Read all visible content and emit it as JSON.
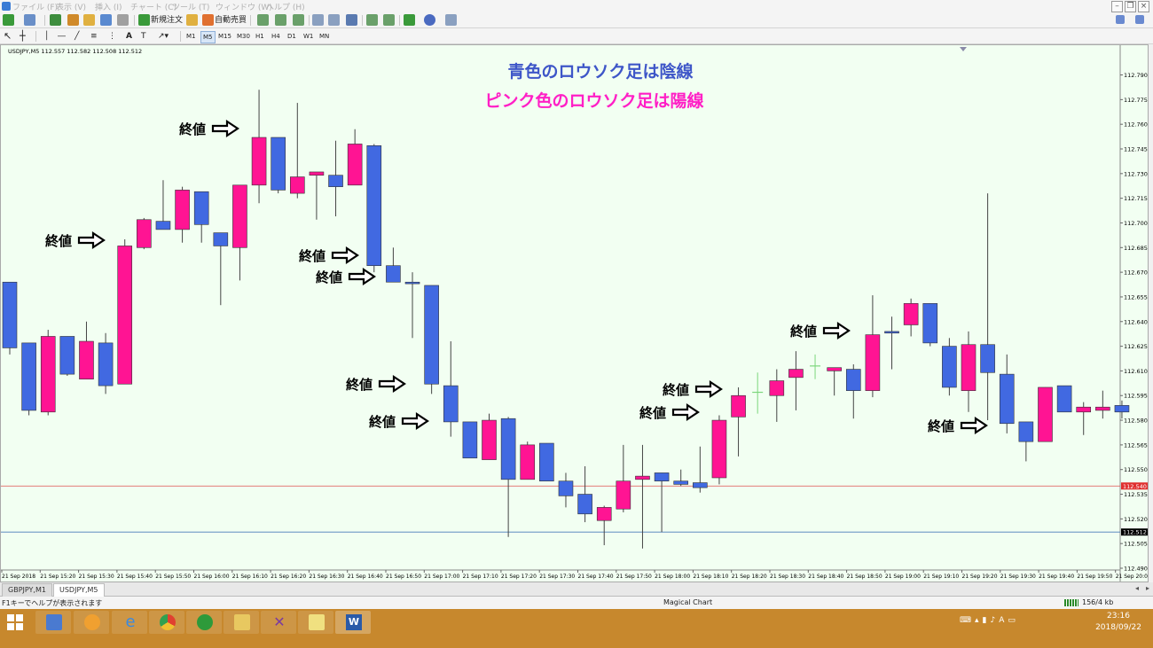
{
  "menubar": {
    "items": [
      "ファイル (F)",
      "表示 (V)",
      "挿入 (I)",
      "チャート (C)",
      "ツール (T)",
      "ウィンドウ (W)",
      "ヘルプ (H)"
    ]
  },
  "toolbar1": {
    "new_order_label": "新規注文",
    "auto_trade_label": "自動売買"
  },
  "toolbar2": {
    "timeframes": [
      "M1",
      "M5",
      "M15",
      "M30",
      "H1",
      "H4",
      "D1",
      "W1",
      "MN"
    ],
    "active_timeframe": "M5"
  },
  "chart_info": "USDJPY,M5  112.557 112.582 112.508 112.512",
  "annotations": {
    "line1": "青色のロウソク足は陰線",
    "line2": "ピンク色のロウソク足は陽線",
    "close_label": "終値"
  },
  "colors": {
    "bear_candle": "#4169e1",
    "bull_candle": "#ff1493",
    "annotation_blue": "#3e56c8",
    "annotation_pink": "#ff1fc6",
    "chart_bg": "#f2fff2",
    "red_line": "#e05050",
    "blue_line": "#4a7ab8",
    "doji_green": "#7cd67c",
    "taskbar": "#c7882d"
  },
  "chart_data": {
    "type": "candlestick",
    "ylim": [
      112.49,
      112.807
    ],
    "y_ticks": [
      "112.790",
      "112.775",
      "112.760",
      "112.745",
      "112.730",
      "112.715",
      "112.700",
      "112.685",
      "112.670",
      "112.655",
      "112.640",
      "112.625",
      "112.610",
      "112.595",
      "112.580",
      "112.565",
      "112.550",
      "112.535",
      "112.520",
      "112.505",
      "112.490"
    ],
    "x_ticks": [
      "21 Sep 2018",
      "21 Sep 15:20",
      "21 Sep 15:30",
      "21 Sep 15:40",
      "21 Sep 15:50",
      "21 Sep 16:00",
      "21 Sep 16:10",
      "21 Sep 16:20",
      "21 Sep 16:30",
      "21 Sep 16:40",
      "21 Sep 16:50",
      "21 Sep 17:00",
      "21 Sep 17:10",
      "21 Sep 17:20",
      "21 Sep 17:30",
      "21 Sep 17:40",
      "21 Sep 17:50",
      "21 Sep 18:00",
      "21 Sep 18:10",
      "21 Sep 18:20",
      "21 Sep 18:30",
      "21 Sep 18:40",
      "21 Sep 18:50",
      "21 Sep 19:00",
      "21 Sep 19:10",
      "21 Sep 19:20",
      "21 Sep 19:30",
      "21 Sep 19:40",
      "21 Sep 19:50",
      "21 Sep 20:00"
    ],
    "price_levels": [
      {
        "value": 112.54,
        "label": "112.540",
        "color": "#e05050"
      },
      {
        "value": 112.512,
        "label": "112.512",
        "color": "#4a7ab8"
      }
    ],
    "candles": [
      {
        "o": 112.664,
        "h": 112.664,
        "l": 112.62,
        "c": 112.624,
        "dir": "bear"
      },
      {
        "o": 112.627,
        "h": 112.627,
        "l": 112.583,
        "c": 112.586,
        "dir": "bear"
      },
      {
        "o": 112.585,
        "h": 112.635,
        "l": 112.583,
        "c": 112.631,
        "dir": "bull"
      },
      {
        "o": 112.631,
        "h": 112.631,
        "l": 112.607,
        "c": 112.608,
        "dir": "bear"
      },
      {
        "o": 112.605,
        "h": 112.64,
        "l": 112.605,
        "c": 112.628,
        "dir": "bull"
      },
      {
        "o": 112.627,
        "h": 112.633,
        "l": 112.596,
        "c": 112.601,
        "dir": "bear"
      },
      {
        "o": 112.602,
        "h": 112.69,
        "l": 112.602,
        "c": 112.686,
        "dir": "bull"
      },
      {
        "o": 112.685,
        "h": 112.703,
        "l": 112.684,
        "c": 112.702,
        "dir": "bull"
      },
      {
        "o": 112.701,
        "h": 112.726,
        "l": 112.7,
        "c": 112.696,
        "dir": "bear"
      },
      {
        "o": 112.696,
        "h": 112.722,
        "l": 112.688,
        "c": 112.72,
        "dir": "bull"
      },
      {
        "o": 112.719,
        "h": 112.719,
        "l": 112.688,
        "c": 112.699,
        "dir": "bear"
      },
      {
        "o": 112.694,
        "h": 112.694,
        "l": 112.65,
        "c": 112.686,
        "dir": "bear"
      },
      {
        "o": 112.685,
        "h": 112.723,
        "l": 112.665,
        "c": 112.723,
        "dir": "bull"
      },
      {
        "o": 112.723,
        "h": 112.781,
        "l": 112.712,
        "c": 112.752,
        "dir": "bull"
      },
      {
        "o": 112.752,
        "h": 112.752,
        "l": 112.718,
        "c": 112.72,
        "dir": "bear"
      },
      {
        "o": 112.718,
        "h": 112.773,
        "l": 112.715,
        "c": 112.728,
        "dir": "bull"
      },
      {
        "o": 112.729,
        "h": 112.729,
        "l": 112.702,
        "c": 112.731,
        "dir": "bull"
      },
      {
        "o": 112.729,
        "h": 112.75,
        "l": 112.704,
        "c": 112.722,
        "dir": "bear"
      },
      {
        "o": 112.723,
        "h": 112.757,
        "l": 112.723,
        "c": 112.748,
        "dir": "bull"
      },
      {
        "o": 112.747,
        "h": 112.748,
        "l": 112.67,
        "c": 112.674,
        "dir": "bear"
      },
      {
        "o": 112.674,
        "h": 112.685,
        "l": 112.665,
        "c": 112.664,
        "dir": "bear"
      },
      {
        "o": 112.664,
        "h": 112.67,
        "l": 112.63,
        "c": 112.663,
        "dir": "bear"
      },
      {
        "o": 112.662,
        "h": 112.662,
        "l": 112.596,
        "c": 112.602,
        "dir": "bear"
      },
      {
        "o": 112.601,
        "h": 112.628,
        "l": 112.57,
        "c": 112.579,
        "dir": "bear"
      },
      {
        "o": 112.579,
        "h": 112.579,
        "l": 112.557,
        "c": 112.557,
        "dir": "bear"
      },
      {
        "o": 112.556,
        "h": 112.584,
        "l": 112.556,
        "c": 112.58,
        "dir": "bull"
      },
      {
        "o": 112.581,
        "h": 112.582,
        "l": 112.509,
        "c": 112.544,
        "dir": "bear"
      },
      {
        "o": 112.544,
        "h": 112.567,
        "l": 112.544,
        "c": 112.565,
        "dir": "bull"
      },
      {
        "o": 112.566,
        "h": 112.566,
        "l": 112.543,
        "c": 112.543,
        "dir": "bear"
      },
      {
        "o": 112.543,
        "h": 112.548,
        "l": 112.527,
        "c": 112.534,
        "dir": "bear"
      },
      {
        "o": 112.535,
        "h": 112.552,
        "l": 112.518,
        "c": 112.523,
        "dir": "bear"
      },
      {
        "o": 112.519,
        "h": 112.528,
        "l": 112.504,
        "c": 112.527,
        "dir": "bull"
      },
      {
        "o": 112.526,
        "h": 112.565,
        "l": 112.524,
        "c": 112.543,
        "dir": "bull"
      },
      {
        "o": 112.544,
        "h": 112.565,
        "l": 112.502,
        "c": 112.546,
        "dir": "bull"
      },
      {
        "o": 112.548,
        "h": 112.548,
        "l": 112.512,
        "c": 112.543,
        "dir": "bear"
      },
      {
        "o": 112.543,
        "h": 112.55,
        "l": 112.54,
        "c": 112.541,
        "dir": "bear"
      },
      {
        "o": 112.542,
        "h": 112.564,
        "l": 112.536,
        "c": 112.539,
        "dir": "bear"
      },
      {
        "o": 112.545,
        "h": 112.583,
        "l": 112.541,
        "c": 112.58,
        "dir": "bull"
      },
      {
        "o": 112.582,
        "h": 112.6,
        "l": 112.558,
        "c": 112.595,
        "dir": "bull"
      },
      {
        "o": 112.597,
        "h": 112.609,
        "l": 112.584,
        "c": 112.597,
        "dir": "doji"
      },
      {
        "o": 112.595,
        "h": 112.611,
        "l": 112.579,
        "c": 112.604,
        "dir": "bull"
      },
      {
        "o": 112.606,
        "h": 112.622,
        "l": 112.586,
        "c": 112.611,
        "dir": "bull"
      },
      {
        "o": 112.613,
        "h": 112.62,
        "l": 112.605,
        "c": 112.613,
        "dir": "doji"
      },
      {
        "o": 112.61,
        "h": 112.612,
        "l": 112.595,
        "c": 112.612,
        "dir": "bull"
      },
      {
        "o": 112.611,
        "h": 112.614,
        "l": 112.581,
        "c": 112.598,
        "dir": "bear"
      },
      {
        "o": 112.598,
        "h": 112.656,
        "l": 112.594,
        "c": 112.632,
        "dir": "bull"
      },
      {
        "o": 112.633,
        "h": 112.643,
        "l": 112.611,
        "c": 112.634,
        "dir": "bear"
      },
      {
        "o": 112.638,
        "h": 112.654,
        "l": 112.631,
        "c": 112.651,
        "dir": "bull"
      },
      {
        "o": 112.651,
        "h": 112.651,
        "l": 112.625,
        "c": 112.627,
        "dir": "bear"
      },
      {
        "o": 112.625,
        "h": 112.63,
        "l": 112.595,
        "c": 112.6,
        "dir": "bear"
      },
      {
        "o": 112.598,
        "h": 112.634,
        "l": 112.585,
        "c": 112.626,
        "dir": "bull"
      },
      {
        "o": 112.626,
        "h": 112.718,
        "l": 112.58,
        "c": 112.609,
        "dir": "bear"
      },
      {
        "o": 112.608,
        "h": 112.62,
        "l": 112.572,
        "c": 112.578,
        "dir": "bear"
      },
      {
        "o": 112.579,
        "h": 112.579,
        "l": 112.555,
        "c": 112.567,
        "dir": "bear"
      },
      {
        "o": 112.567,
        "h": 112.6,
        "l": 112.567,
        "c": 112.6,
        "dir": "bull"
      },
      {
        "o": 112.601,
        "h": 112.601,
        "l": 112.586,
        "c": 112.585,
        "dir": "bear"
      },
      {
        "o": 112.585,
        "h": 112.591,
        "l": 112.571,
        "c": 112.588,
        "dir": "bull"
      },
      {
        "o": 112.586,
        "h": 112.598,
        "l": 112.581,
        "c": 112.588,
        "dir": "bull"
      },
      {
        "o": 112.589,
        "h": 112.592,
        "l": 112.581,
        "c": 112.585,
        "dir": "bear"
      }
    ],
    "close_arrows": [
      {
        "x": 201,
        "y": 144
      },
      {
        "x": 50,
        "y": 270
      },
      {
        "x": 336,
        "y": 287
      },
      {
        "x": 355,
        "y": 311
      },
      {
        "x": 389,
        "y": 432
      },
      {
        "x": 415,
        "y": 474
      },
      {
        "x": 746,
        "y": 438
      },
      {
        "x": 720,
        "y": 464
      },
      {
        "x": 890,
        "y": 372
      },
      {
        "x": 1045,
        "y": 479
      }
    ]
  },
  "tabs": [
    {
      "label": "GBPJPY,M1",
      "active": false
    },
    {
      "label": "USDJPY,M5",
      "active": true
    }
  ],
  "status_bar": {
    "help_text": "F1キーでヘルプが表示されます",
    "profile": "Magical Chart",
    "traffic": "156/4 kb"
  },
  "taskbar": {
    "apps": [
      "file-explorer",
      "ie",
      "chrome",
      "app-n",
      "folder",
      "app-x",
      "app-folder2",
      "word"
    ],
    "time": "23:16",
    "date": "2018/09/22"
  }
}
